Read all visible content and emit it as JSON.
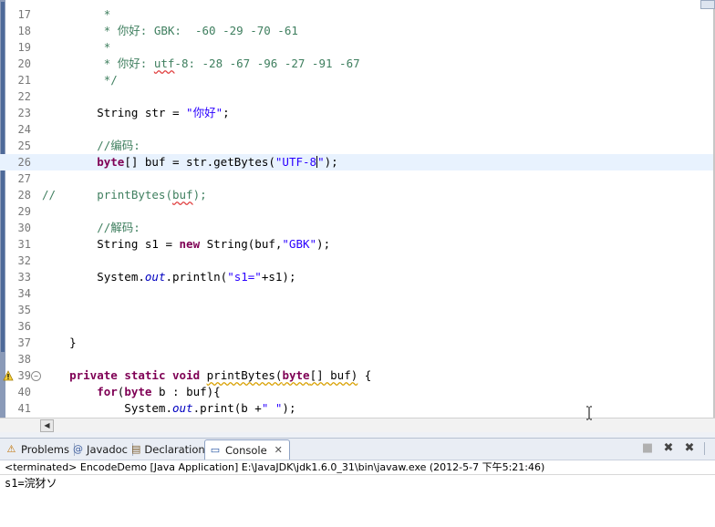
{
  "editor": {
    "lines": [
      {
        "n": "17",
        "parts": [
          {
            "t": "         *",
            "c": "cm"
          }
        ]
      },
      {
        "n": "18",
        "parts": [
          {
            "t": "         * 你好: GBK:  -60 -29 -70 -61",
            "c": "cm"
          }
        ]
      },
      {
        "n": "19",
        "parts": [
          {
            "t": "         *",
            "c": "cm"
          }
        ]
      },
      {
        "n": "20",
        "parts": [
          {
            "t": "         * 你好: ",
            "c": "cm"
          },
          {
            "t": "utf",
            "c": "cm squigr"
          },
          {
            "t": "-8: -28 -67 -96 -27 -91 -67",
            "c": "cm"
          }
        ]
      },
      {
        "n": "21",
        "parts": [
          {
            "t": "         */",
            "c": "cm"
          }
        ]
      },
      {
        "n": "22",
        "parts": []
      },
      {
        "n": "23",
        "parts": [
          {
            "t": "        String str = "
          },
          {
            "t": "\"你好\"",
            "c": "st"
          },
          {
            "t": ";"
          }
        ]
      },
      {
        "n": "24",
        "parts": []
      },
      {
        "n": "25",
        "parts": [
          {
            "t": "        //编码:",
            "c": "cm"
          }
        ]
      },
      {
        "n": "26",
        "hl": true,
        "parts": [
          {
            "t": "        "
          },
          {
            "t": "byte",
            "c": "kw"
          },
          {
            "t": "[] buf = str.getBytes("
          },
          {
            "t": "\"UTF-8",
            "c": "st"
          },
          {
            "caret": true
          },
          {
            "t": "\"",
            "c": "st"
          },
          {
            "t": ");"
          }
        ]
      },
      {
        "n": "27",
        "parts": []
      },
      {
        "n": "28",
        "parts": [
          {
            "t": "//      printBytes(",
            "c": "cm"
          },
          {
            "t": "buf",
            "c": "cm squigr"
          },
          {
            "t": ");",
            "c": "cm"
          }
        ]
      },
      {
        "n": "29",
        "parts": []
      },
      {
        "n": "30",
        "parts": [
          {
            "t": "        //解码:",
            "c": "cm"
          }
        ]
      },
      {
        "n": "31",
        "parts": [
          {
            "t": "        String s1 = "
          },
          {
            "t": "new",
            "c": "kw"
          },
          {
            "t": " String(buf,"
          },
          {
            "t": "\"GBK\"",
            "c": "st"
          },
          {
            "t": ");"
          }
        ]
      },
      {
        "n": "32",
        "parts": []
      },
      {
        "n": "33",
        "parts": [
          {
            "t": "        System."
          },
          {
            "t": "out",
            "c": "it"
          },
          {
            "t": ".println("
          },
          {
            "t": "\"s1=\"",
            "c": "st"
          },
          {
            "t": "+s1);"
          }
        ]
      },
      {
        "n": "34",
        "parts": []
      },
      {
        "n": "35",
        "parts": []
      },
      {
        "n": "36",
        "parts": []
      },
      {
        "n": "37",
        "parts": [
          {
            "t": "    }"
          }
        ]
      },
      {
        "n": "38",
        "parts": []
      },
      {
        "n": "39",
        "warn": true,
        "fold": true,
        "parts": [
          {
            "t": "    "
          },
          {
            "t": "private",
            "c": "kw"
          },
          {
            "t": " "
          },
          {
            "t": "static",
            "c": "kw"
          },
          {
            "t": " "
          },
          {
            "t": "void",
            "c": "kw"
          },
          {
            "t": " "
          },
          {
            "t": "printBytes(",
            "c": "squig"
          },
          {
            "t": "byte",
            "c": "kw squig"
          },
          {
            "t": "[] buf)",
            "c": "squig"
          },
          {
            "t": " {"
          }
        ]
      },
      {
        "n": "40",
        "parts": [
          {
            "t": "        "
          },
          {
            "t": "for",
            "c": "kw"
          },
          {
            "t": "("
          },
          {
            "t": "byte",
            "c": "kw"
          },
          {
            "t": " b : buf){"
          }
        ]
      },
      {
        "n": "41",
        "parts": [
          {
            "t": "            System."
          },
          {
            "t": "out",
            "c": "it"
          },
          {
            "t": ".print(b +"
          },
          {
            "t": "\" \"",
            "c": "st"
          },
          {
            "t": ");"
          }
        ]
      }
    ]
  },
  "panel": {
    "tabs": [
      {
        "label": "Problems",
        "icon": "problems-icon",
        "glyph": "⚠",
        "color": "#c07000"
      },
      {
        "label": "Javadoc",
        "icon": "javadoc-icon",
        "glyph": "@",
        "color": "#4060a0"
      },
      {
        "label": "Declaration",
        "icon": "declaration-icon",
        "glyph": "▤",
        "color": "#806030"
      },
      {
        "label": "Console",
        "icon": "console-icon",
        "glyph": "▭",
        "color": "#2050a0",
        "active": true,
        "close": "✕"
      }
    ],
    "toolbar": {
      "terminate": "■",
      "remove": "✖",
      "remove_all": "✖"
    },
    "console_header": "<terminated> EncodeDemo [Java Application] E:\\JavaJDK\\jdk1.6.0_31\\bin\\javaw.exe (2012-5-7 下午5:21:46)",
    "console_output": "s1=浣犲ソ"
  },
  "colors": {
    "keyword": "#7f0055",
    "comment": "#3f7f5f",
    "string": "#2a00ff",
    "field": "#0000c0",
    "line_highlight": "#e8f2fe"
  }
}
